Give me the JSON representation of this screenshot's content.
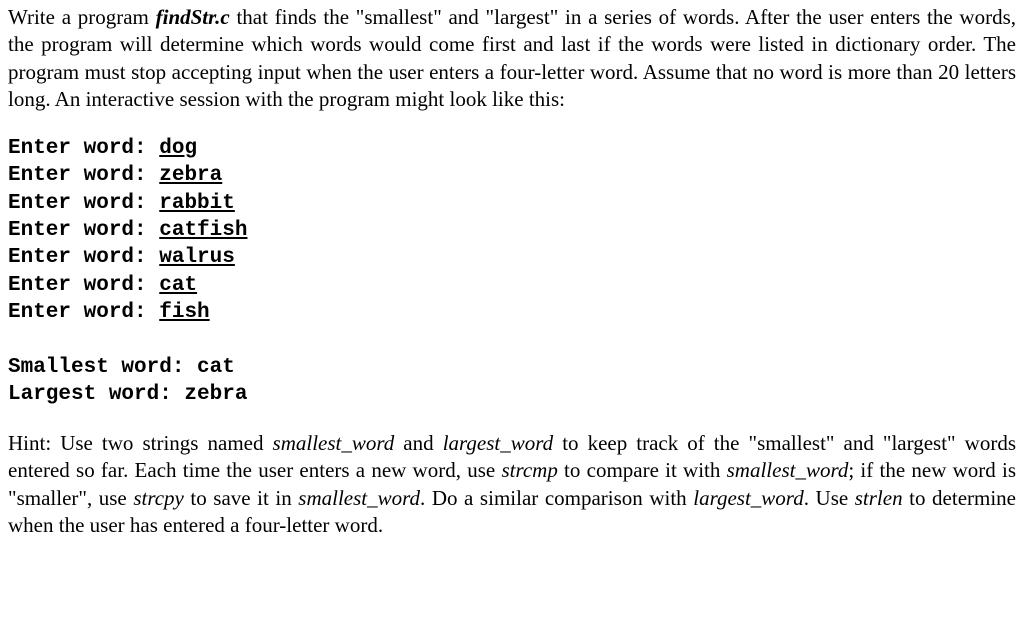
{
  "intro": {
    "part1": "Write a program ",
    "filename": "findStr.c",
    "part2": " that finds the \"smallest\" and \"largest\" in a series of words. After the user enters the words, the program will determine which words would come first and last if the words were listed in dictionary order. The program must stop accepting input when the user enters a four-letter word. Assume that no word is more than 20 letters long. An interactive session with the program might look like this:"
  },
  "session": {
    "prompts": [
      {
        "prompt": "Enter word: ",
        "input": "dog"
      },
      {
        "prompt": "Enter word: ",
        "input": "zebra"
      },
      {
        "prompt": "Enter word: ",
        "input": "rabbit"
      },
      {
        "prompt": "Enter word: ",
        "input": "catfish"
      },
      {
        "prompt": "Enter word: ",
        "input": "walrus"
      },
      {
        "prompt": "Enter word: ",
        "input": "cat"
      },
      {
        "prompt": "Enter word: ",
        "input": "fish"
      }
    ],
    "results": [
      "Smallest word: cat",
      "Largest word: zebra"
    ]
  },
  "hint": {
    "part1": "Hint: Use two strings named ",
    "sw1": "smallest_word",
    "part2": " and ",
    "lw1": "largest_word",
    "part3": " to keep track of the \"smallest\" and \"largest\" words entered so far. Each time the user enters a new word, use ",
    "strcmp": "strcmp",
    "part4": " to compare it with ",
    "sw2": "smallest_word",
    "part5": "; if the new word is \"smaller\", use ",
    "strcpy": "strcpy",
    "part6": " to save it in ",
    "sw3": "smallest_word",
    "part7": ". Do a similar comparison with ",
    "lw2": "largest_word",
    "part8": ". Use ",
    "strlen": "strlen",
    "part9": " to determine when the user has entered a four-letter word."
  }
}
